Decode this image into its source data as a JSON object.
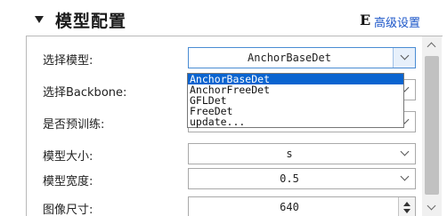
{
  "header": {
    "title": "模型配置",
    "advanced_icon": "E",
    "advanced_label": "高级设置"
  },
  "form": {
    "rows": [
      {
        "label": "选择模型:",
        "value": "AnchorBaseDet",
        "control": "dropdown-open"
      },
      {
        "label": "选择Backbone:",
        "value": "",
        "control": "dropdown"
      },
      {
        "label": "是否预训练:",
        "value": "",
        "control": "dropdown"
      },
      {
        "label": "模型大小:",
        "value": "s",
        "control": "dropdown"
      },
      {
        "label": "模型宽度:",
        "value": "0.5",
        "control": "dropdown"
      },
      {
        "label": "图像尺寸:",
        "value": "640",
        "control": "spinbox"
      }
    ]
  },
  "model_dropdown": {
    "options": [
      "AnchorBaseDet",
      "AnchorFreeDet",
      "GFLDet",
      "FreeDet",
      "update..."
    ],
    "selected_index": 0
  },
  "icons": {
    "collapse": "triangle-down-icon",
    "dropdown": "chevron-down-icon",
    "scroll_up": "chevron-up-icon",
    "scroll_down": "chevron-down-icon"
  },
  "colors": {
    "link": "#1a55c8",
    "selection": "#0a64d0",
    "focus_border": "#4a8cd3"
  }
}
